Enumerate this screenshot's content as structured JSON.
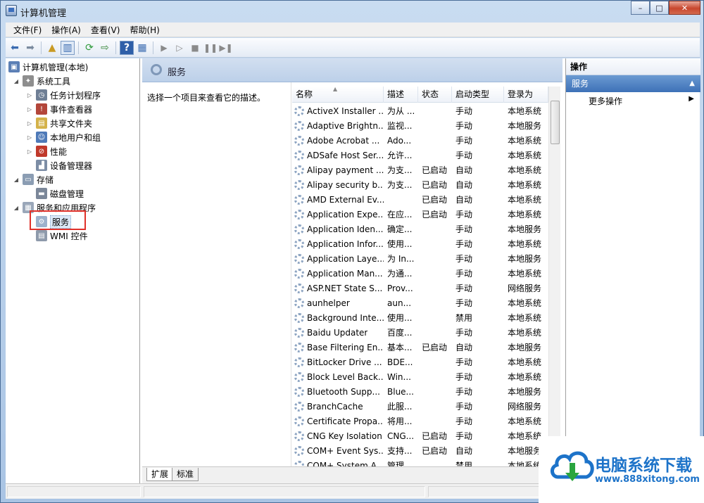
{
  "window": {
    "title": "计算机管理",
    "buttons": [
      "–",
      "□",
      "✕"
    ]
  },
  "menu": [
    "文件(F)",
    "操作(A)",
    "查看(V)",
    "帮助(H)"
  ],
  "tree": {
    "root": "计算机管理(本地)",
    "system_tools": "系统工具",
    "task_scheduler": "任务计划程序",
    "event_viewer": "事件查看器",
    "shared_folders": "共享文件夹",
    "local_users": "本地用户和组",
    "performance": "性能",
    "device_manager": "设备管理器",
    "storage": "存储",
    "disk_management": "磁盘管理",
    "services_apps": "服务和应用程序",
    "services": "服务",
    "wmi": "WMI 控件"
  },
  "middle": {
    "header_title": "服务",
    "description_hint": "选择一个项目来查看它的描述。"
  },
  "columns": {
    "name": "名称",
    "desc": "描述",
    "status": "状态",
    "startup": "启动类型",
    "logon": "登录为"
  },
  "services": [
    {
      "name": "ActiveX Installer ...",
      "desc": "为从 ...",
      "status": "",
      "startup": "手动",
      "logon": "本地系统"
    },
    {
      "name": "Adaptive Brightn...",
      "desc": "监视...",
      "status": "",
      "startup": "手动",
      "logon": "本地服务"
    },
    {
      "name": "Adobe Acrobat ...",
      "desc": "Ado...",
      "status": "",
      "startup": "手动",
      "logon": "本地系统"
    },
    {
      "name": "ADSafe Host Ser...",
      "desc": "允许...",
      "status": "",
      "startup": "手动",
      "logon": "本地系统"
    },
    {
      "name": "Alipay payment ...",
      "desc": "为支...",
      "status": "已启动",
      "startup": "自动",
      "logon": "本地系统"
    },
    {
      "name": "Alipay security b...",
      "desc": "为支...",
      "status": "已启动",
      "startup": "自动",
      "logon": "本地系统"
    },
    {
      "name": "AMD External Ev...",
      "desc": "",
      "status": "已启动",
      "startup": "自动",
      "logon": "本地系统"
    },
    {
      "name": "Application Expe...",
      "desc": "在应...",
      "status": "已启动",
      "startup": "手动",
      "logon": "本地系统"
    },
    {
      "name": "Application Iden...",
      "desc": "确定...",
      "status": "",
      "startup": "手动",
      "logon": "本地服务"
    },
    {
      "name": "Application Infor...",
      "desc": "使用...",
      "status": "",
      "startup": "手动",
      "logon": "本地系统"
    },
    {
      "name": "Application Laye...",
      "desc": "为 In...",
      "status": "",
      "startup": "手动",
      "logon": "本地服务"
    },
    {
      "name": "Application Man...",
      "desc": "为通...",
      "status": "",
      "startup": "手动",
      "logon": "本地系统"
    },
    {
      "name": "ASP.NET State S...",
      "desc": "Prov...",
      "status": "",
      "startup": "手动",
      "logon": "网络服务"
    },
    {
      "name": "aunhelper",
      "desc": "aun...",
      "status": "",
      "startup": "手动",
      "logon": "本地系统"
    },
    {
      "name": "Background Inte...",
      "desc": "使用...",
      "status": "",
      "startup": "禁用",
      "logon": "本地系统"
    },
    {
      "name": "Baidu Updater",
      "desc": "百度...",
      "status": "",
      "startup": "手动",
      "logon": "本地系统"
    },
    {
      "name": "Base Filtering En...",
      "desc": "基本...",
      "status": "已启动",
      "startup": "自动",
      "logon": "本地服务"
    },
    {
      "name": "BitLocker Drive ...",
      "desc": "BDE...",
      "status": "",
      "startup": "手动",
      "logon": "本地系统"
    },
    {
      "name": "Block Level Back...",
      "desc": "Win...",
      "status": "",
      "startup": "手动",
      "logon": "本地系统"
    },
    {
      "name": "Bluetooth Supp...",
      "desc": "Blue...",
      "status": "",
      "startup": "手动",
      "logon": "本地服务"
    },
    {
      "name": "BranchCache",
      "desc": "此服...",
      "status": "",
      "startup": "手动",
      "logon": "网络服务"
    },
    {
      "name": "Certificate Propa...",
      "desc": "将用...",
      "status": "",
      "startup": "手动",
      "logon": "本地系统"
    },
    {
      "name": "CNG Key Isolation",
      "desc": "CNG...",
      "status": "已启动",
      "startup": "手动",
      "logon": "本地系统"
    },
    {
      "name": "COM+ Event Sys...",
      "desc": "支持...",
      "status": "已启动",
      "startup": "自动",
      "logon": "本地服务"
    },
    {
      "name": "COM+ System A...",
      "desc": "管理...",
      "status": "",
      "startup": "禁用",
      "logon": "本地系统"
    }
  ],
  "tabs": [
    "扩展",
    "标准"
  ],
  "actions": {
    "title": "操作",
    "section": "服务",
    "more": "更多操作"
  },
  "watermark": {
    "title": "电脑系统下载",
    "url": "www.888xitong.com"
  }
}
